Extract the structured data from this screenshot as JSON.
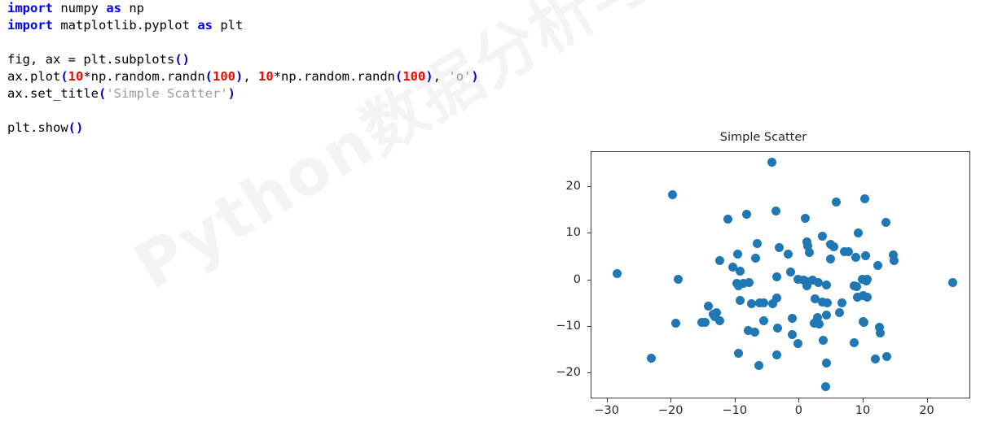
{
  "watermark": {
    "text": "Python数据分析与可视化"
  },
  "code": {
    "language": "python",
    "lines": [
      {
        "id": "line-1",
        "tokens": [
          {
            "t": "import",
            "c": "kw"
          },
          {
            "t": " numpy ",
            "c": "plain"
          },
          {
            "t": "as",
            "c": "kw2"
          },
          {
            "t": " np",
            "c": "plain"
          }
        ]
      },
      {
        "id": "line-2",
        "tokens": [
          {
            "t": "import",
            "c": "kw"
          },
          {
            "t": " matplotlib.pyplot ",
            "c": "plain"
          },
          {
            "t": "as",
            "c": "kw2"
          },
          {
            "t": " plt",
            "c": "plain"
          }
        ]
      },
      {
        "id": "line-3",
        "tokens": []
      },
      {
        "id": "line-4",
        "tokens": [
          {
            "t": "fig, ax = plt.subplots",
            "c": "plain"
          },
          {
            "t": "()",
            "c": "paren"
          }
        ]
      },
      {
        "id": "line-5",
        "tokens": [
          {
            "t": "ax.plot",
            "c": "plain"
          },
          {
            "t": "(",
            "c": "paren"
          },
          {
            "t": "10",
            "c": "num"
          },
          {
            "t": "*np.random.randn",
            "c": "plain"
          },
          {
            "t": "(",
            "c": "paren"
          },
          {
            "t": "100",
            "c": "num"
          },
          {
            "t": ")",
            "c": "paren"
          },
          {
            "t": ", ",
            "c": "plain"
          },
          {
            "t": "10",
            "c": "num"
          },
          {
            "t": "*np.random.randn",
            "c": "plain"
          },
          {
            "t": "(",
            "c": "paren"
          },
          {
            "t": "100",
            "c": "num"
          },
          {
            "t": ")",
            "c": "paren"
          },
          {
            "t": ", ",
            "c": "plain"
          },
          {
            "t": "'o'",
            "c": "str"
          },
          {
            "t": ")",
            "c": "paren"
          }
        ]
      },
      {
        "id": "line-6",
        "tokens": [
          {
            "t": "ax.set_title",
            "c": "plain"
          },
          {
            "t": "(",
            "c": "paren"
          },
          {
            "t": "'Simple Scatter'",
            "c": "str"
          },
          {
            "t": ")",
            "c": "paren"
          }
        ]
      },
      {
        "id": "line-7",
        "tokens": []
      },
      {
        "id": "line-8",
        "tokens": [
          {
            "t": "plt.show",
            "c": "plain"
          },
          {
            "t": "()",
            "c": "paren"
          }
        ]
      }
    ],
    "plain_text": "import numpy as np\nimport matplotlib.pyplot as plt\n\nfig, ax = plt.subplots()\nax.plot(10*np.random.randn(100), 10*np.random.randn(100), 'o')\nax.set_title('Simple Scatter')\n\nplt.show()"
  },
  "chart_data": {
    "type": "scatter",
    "title": "Simple Scatter",
    "xlabel": "",
    "ylabel": "",
    "marker": "o",
    "marker_color": "#1f77b4",
    "marker_size": 11,
    "grid": false,
    "legend": null,
    "xlim": [
      -32.5,
      26.8
    ],
    "ylim": [
      -25.5,
      27.5
    ],
    "xticks": [
      -30,
      -20,
      -10,
      0,
      10,
      20
    ],
    "yticks": [
      -20,
      -10,
      0,
      10,
      20
    ],
    "xticklabels": [
      "−30",
      "−20",
      "−10",
      "0",
      "10",
      "20"
    ],
    "yticklabels": [
      "−20",
      "−10",
      "0",
      "10",
      "20"
    ],
    "n_points": 100,
    "points": [
      [
        -4.3,
        25.3
      ],
      [
        -19.9,
        18.4
      ],
      [
        -11.2,
        13.2
      ],
      [
        -8.3,
        14.1
      ],
      [
        -3.7,
        14.9
      ],
      [
        5.8,
        16.8
      ],
      [
        10.2,
        17.4
      ],
      [
        0.9,
        13.3
      ],
      [
        13.5,
        12.4
      ],
      [
        9.2,
        10.2
      ],
      [
        -6.6,
        7.8
      ],
      [
        -3.2,
        7.0
      ],
      [
        1.1,
        8.2
      ],
      [
        1.3,
        7.3
      ],
      [
        3.6,
        9.4
      ],
      [
        4.9,
        7.7
      ],
      [
        5.3,
        7.2
      ],
      [
        1.5,
        6.0
      ],
      [
        7.0,
        6.2
      ],
      [
        7.6,
        6.1
      ],
      [
        -9.6,
        5.6
      ],
      [
        -1.8,
        5.6
      ],
      [
        8.8,
        5.0
      ],
      [
        10.3,
        5.3
      ],
      [
        -12.5,
        4.3
      ],
      [
        -6.9,
        4.8
      ],
      [
        4.8,
        4.6
      ],
      [
        -10.4,
        2.8
      ],
      [
        14.7,
        5.5
      ],
      [
        14.8,
        4.2
      ],
      [
        12.2,
        3.2
      ],
      [
        -28.5,
        1.5
      ],
      [
        -9.3,
        1.9
      ],
      [
        -1.4,
        1.8
      ],
      [
        -3.5,
        0.7
      ],
      [
        -19.0,
        0.2
      ],
      [
        24.0,
        -0.4
      ],
      [
        -9.8,
        -0.6
      ],
      [
        -8.8,
        -0.6
      ],
      [
        -9.5,
        -1.2
      ],
      [
        -7.9,
        -0.5
      ],
      [
        0.6,
        0.1
      ],
      [
        1.1,
        -0.3
      ],
      [
        2.1,
        0.0
      ],
      [
        1.2,
        -1.2
      ],
      [
        3.0,
        -0.4
      ],
      [
        4.2,
        -1.0
      ],
      [
        9.8,
        0.2
      ],
      [
        10.6,
        0.3
      ],
      [
        10.5,
        -0.1
      ],
      [
        8.5,
        -1.1
      ],
      [
        8.9,
        -1.4
      ],
      [
        -13.0,
        -7.0
      ],
      [
        -13.5,
        -7.3
      ],
      [
        -14.2,
        -5.5
      ],
      [
        -14.8,
        -9.1
      ],
      [
        -19.3,
        -9.2
      ],
      [
        -9.3,
        -4.4
      ],
      [
        -7.5,
        -5.1
      ],
      [
        -6.2,
        -4.9
      ],
      [
        -5.6,
        -4.8
      ],
      [
        -4.2,
        -5.0
      ],
      [
        -3.5,
        -3.8
      ],
      [
        2.4,
        -3.9
      ],
      [
        3.6,
        -4.7
      ],
      [
        4.4,
        -4.9
      ],
      [
        6.2,
        -6.9
      ],
      [
        9.0,
        -3.6
      ],
      [
        9.9,
        -3.2
      ],
      [
        10.6,
        -3.7
      ],
      [
        -1.1,
        -8.1
      ],
      [
        2.8,
        -8.0
      ],
      [
        3.1,
        -9.4
      ],
      [
        4.2,
        -7.4
      ],
      [
        9.9,
        -8.9
      ],
      [
        10.1,
        -9.1
      ],
      [
        -8.0,
        -10.8
      ],
      [
        -7.0,
        -11.1
      ],
      [
        -5.6,
        -8.7
      ],
      [
        -3.4,
        -10.3
      ],
      [
        -1.1,
        -11.6
      ],
      [
        12.5,
        -10.0
      ],
      [
        12.6,
        -11.3
      ],
      [
        -0.3,
        -13.5
      ],
      [
        3.7,
        -12.8
      ],
      [
        8.6,
        -13.4
      ],
      [
        -9.5,
        -15.7
      ],
      [
        -3.6,
        -16.0
      ],
      [
        -23.1,
        -16.7
      ],
      [
        11.9,
        -16.8
      ],
      [
        13.6,
        -16.4
      ],
      [
        -6.3,
        -18.2
      ],
      [
        4.2,
        -17.8
      ],
      [
        4.1,
        -22.8
      ],
      [
        -15.2,
        -9.0
      ],
      [
        -13.2,
        -7.8
      ],
      [
        -0.2,
        0.2
      ],
      [
        2.3,
        -9.2
      ],
      [
        6.6,
        -4.9
      ],
      [
        -12.4,
        -8.6
      ]
    ]
  }
}
